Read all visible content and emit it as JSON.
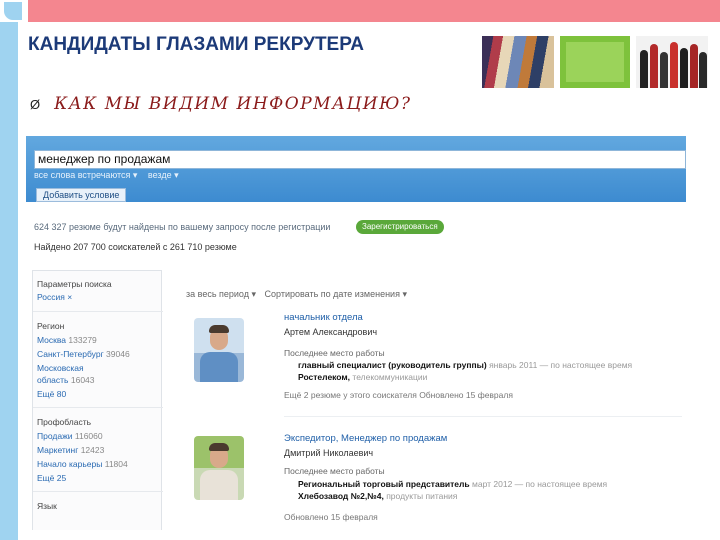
{
  "slide": {
    "title": "КАНДИДАТЫ ГЛАЗАМИ РЕКРУТЕРА",
    "subtitle_bullet": "Ø",
    "subtitle": "КАК МЫ ВИДИМ ИНФОРМАЦИЮ?",
    "colors": {
      "top_bar": "#f4868f",
      "left_bar": "#9fd3f0",
      "title": "#1c3a78",
      "subtitle": "#8a1a1a"
    }
  },
  "search": {
    "query": "менеджер по продажам",
    "options": [
      "все слова встречаются ▾",
      "везде ▾"
    ],
    "add_condition": "Добавить условие",
    "resume_count": "624 327 резюме будут найдены по вашему запросу после регистрации",
    "notify_button": "Зарегистрироваться",
    "found": "Найдено 207 700 соискателей с 261 710 резюме"
  },
  "sidebar": {
    "params_title": "Параметры поиска",
    "params_value": "Россия ×",
    "region_title": "Регион",
    "regions": [
      {
        "name": "Москва",
        "count": "133279"
      },
      {
        "name": "Санкт-Петербург",
        "count": "39046"
      },
      {
        "name": "Московская",
        "count": ""
      },
      {
        "name": "область",
        "count": "16043"
      },
      {
        "name": "Ещё 80",
        "count": ""
      }
    ],
    "prof_title": "Профобласть",
    "profs": [
      {
        "name": "Продажи",
        "count": "116060"
      },
      {
        "name": "Маркетинг",
        "count": "12423"
      },
      {
        "name": "Начало карьеры",
        "count": "11804"
      },
      {
        "name": "Ещё 25",
        "count": ""
      }
    ],
    "language_title": "Язык"
  },
  "sort": {
    "period": "за весь период ▾",
    "order": "Сортировать по дате изменения ▾"
  },
  "results": [
    {
      "title": "начальник отдела",
      "name": "Артем Александрович",
      "last_job_label": "Последнее место работы",
      "position": "главный специалист (руководитель группы)",
      "position_tail": "январь 2011 — по настоящее время",
      "company": "Ростелеком,",
      "company_tail": "телекоммуникации",
      "footer": "Ещё 2 резюме у этого соискателя     Обновлено 15 февраля"
    },
    {
      "title": "Экспедитор, Менеджер по продажам",
      "name": "Дмитрий Николаевич",
      "last_job_label": "Последнее место работы",
      "position": "Региональный торговый представитель",
      "position_tail": "март 2012 — по настоящее время",
      "company": "Хлебозавод №2,№4,",
      "company_tail": "продукты питания",
      "footer": "Обновлено 15 февраля"
    }
  ]
}
